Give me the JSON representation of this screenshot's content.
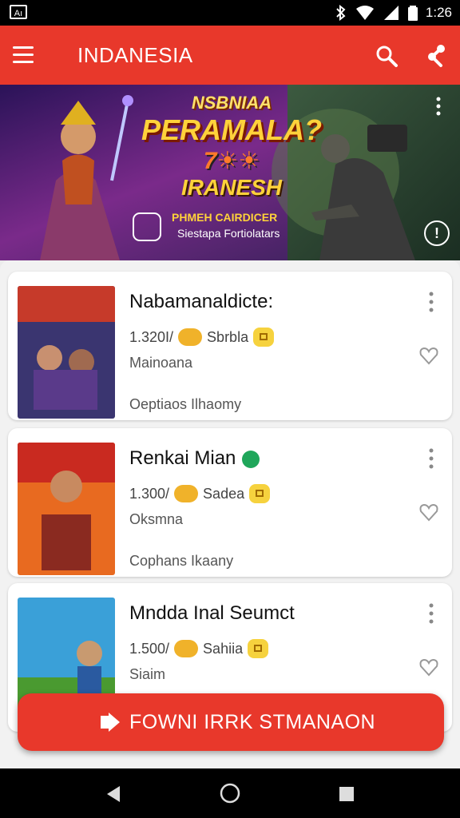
{
  "status_bar": {
    "left_icon": "Aı",
    "time": "1:26",
    "icons": [
      "bluetooth-icon",
      "wifi-icon",
      "signal-icon",
      "battery-icon"
    ]
  },
  "app_bar": {
    "title": "INDANESIA",
    "icons": [
      "menu-icon",
      "search-icon",
      "share-icon"
    ]
  },
  "banner": {
    "line1": "NSBNIAA",
    "line2": "PERAMALA?",
    "line3": "7☀☀",
    "line4": "IRANESH",
    "subtitle": "PHMEH CAIRDICER",
    "subtitle2": "Siestapa Fortiolatars",
    "info_label": "!"
  },
  "games": [
    {
      "title": "Nabamanaldicte:",
      "count": "1.320I/",
      "tag": "Sbrbla",
      "category": "Mainoana",
      "options": "Oeptiaos Ilhaomy",
      "verified": false
    },
    {
      "title": "Renkai Mian",
      "count": "1.300/",
      "tag": "Sadea",
      "category": "Oksmna",
      "options": "Cophans Ikaany",
      "verified": true
    },
    {
      "title": "Mndda Inal Seumct",
      "count": "1.500/",
      "tag": "Sahiia",
      "category": "Siaim",
      "options": "",
      "verified": false
    }
  ],
  "download_button": {
    "label": "FOWNI IRRK STMANAON"
  },
  "colors": {
    "accent": "#e8382b",
    "badge_yellow": "#f6d23e",
    "verified_green": "#1fa65a"
  }
}
